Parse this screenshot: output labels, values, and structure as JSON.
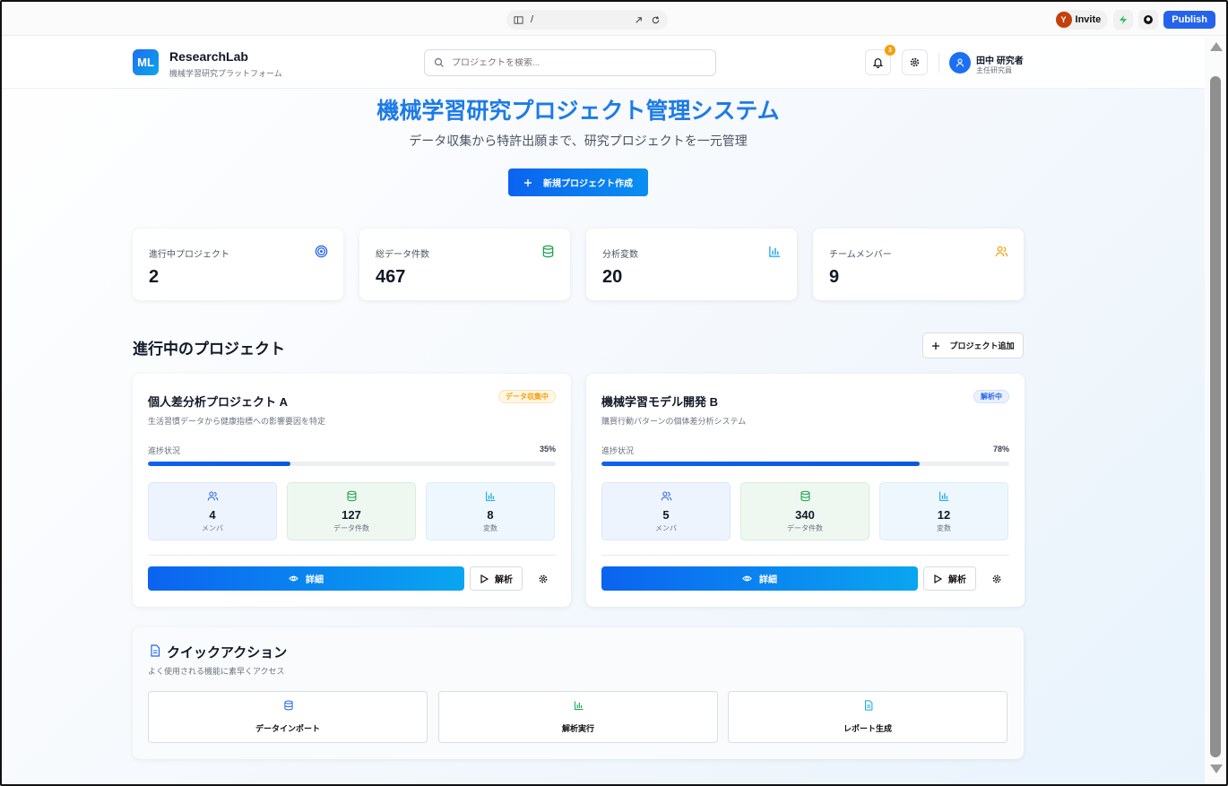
{
  "browser": {
    "url": "/",
    "invite_avatar": "Y",
    "invite_label": "Invite",
    "publish_label": "Publish"
  },
  "header": {
    "logo": "ML",
    "brand": "ResearchLab",
    "brand_sub": "機械学習研究プラットフォーム",
    "search_placeholder": "プロジェクトを検索...",
    "notification_count": "3",
    "user_name": "田中 研究者",
    "user_role": "主任研究員"
  },
  "hero": {
    "title": "機械学習研究プロジェクト管理システム",
    "subtitle": "データ収集から特許出願まで、研究プロジェクトを一元管理",
    "new_project_label": "新規プロジェクト作成"
  },
  "stats": [
    {
      "label": "進行中プロジェクト",
      "value": "2",
      "icon": "target-icon",
      "color": "#2563eb"
    },
    {
      "label": "総データ件数",
      "value": "467",
      "icon": "database-icon",
      "color": "#16a34a"
    },
    {
      "label": "分析変数",
      "value": "20",
      "icon": "bar-chart-icon",
      "color": "#0ea5e9"
    },
    {
      "label": "チームメンバー",
      "value": "9",
      "icon": "users-icon",
      "color": "#f59e0b"
    }
  ],
  "projects_section": {
    "title": "進行中のプロジェクト",
    "add_label": "プロジェクト追加",
    "progress_label": "進捗状況",
    "detail_label": "詳細",
    "analyze_label": "解析",
    "projects": [
      {
        "title": "個人差分析プロジェクト A",
        "badge": "データ収集中",
        "badge_color": "#f59e0b",
        "description": "生活習慣データから健康指標への影響要因を特定",
        "progress_pct": "35%",
        "progress": 35,
        "members": "4",
        "members_label": "メンバ",
        "data_count": "127",
        "data_label": "データ件数",
        "variables": "8",
        "variables_label": "変数"
      },
      {
        "title": "機械学習モデル開発 B",
        "badge": "解析中",
        "badge_color": "#2563eb",
        "description": "購買行動パターンの個体差分析システム",
        "progress_pct": "78%",
        "progress": 78,
        "members": "5",
        "members_label": "メンバ",
        "data_count": "340",
        "data_label": "データ件数",
        "variables": "12",
        "variables_label": "変数"
      }
    ]
  },
  "quick_actions": {
    "title": "クイックアクション",
    "subtitle": "よく使用される機能に素早くアクセス",
    "items": [
      {
        "label": "データインポート",
        "icon": "database-icon"
      },
      {
        "label": "解析実行",
        "icon": "bar-chart-icon"
      },
      {
        "label": "レポート生成",
        "icon": "file-text-icon"
      }
    ]
  }
}
